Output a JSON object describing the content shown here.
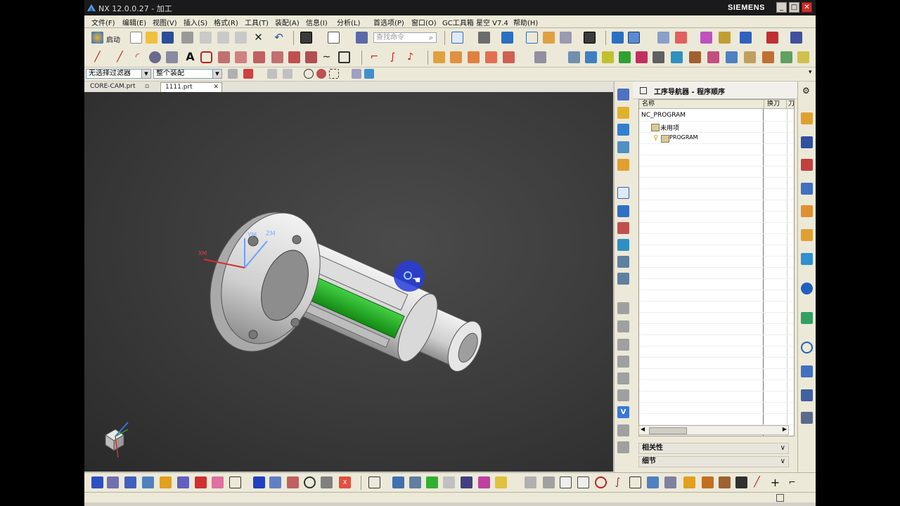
{
  "window": {
    "title": "NX 12.0.0.27 - 加工",
    "brand": "SIEMENS",
    "controls": [
      "minimize",
      "maximize",
      "close"
    ]
  },
  "menu": [
    "文件(F)",
    "编辑(E)",
    "视图(V)",
    "插入(S)",
    "格式(R)",
    "工具(T)",
    "装配(A)",
    "信息(I)",
    "分析(L)",
    "首选项(P)",
    "窗口(O)",
    "GC工具箱",
    "星空 V7.4",
    "帮助(H)"
  ],
  "toolbar": {
    "start_label": "启动",
    "search_placeholder": "查找命令"
  },
  "filters": {
    "selection_filter": "无选择过滤器",
    "assembly_scope": "整个装配"
  },
  "tabs": [
    {
      "label": "CORE-CAM.prt",
      "active": false
    },
    {
      "label": "1111.prt",
      "active": true
    }
  ],
  "viewport": {
    "axes": {
      "x": "XM",
      "y": "YM",
      "z": "ZM"
    },
    "background": "#3c3c3c",
    "highlight_color": "#1faa1f"
  },
  "navigator": {
    "title": "工序导航器 - 程序顺序",
    "columns": [
      "名称",
      "换刀",
      "刀"
    ],
    "tree": [
      {
        "label": "NC_PROGRAM",
        "level": 0,
        "icon": "none"
      },
      {
        "label": "未用项",
        "level": 1,
        "icon": "folder-icon"
      },
      {
        "label": "PROGRAM",
        "level": 1,
        "icon": "folder-icon"
      }
    ],
    "panels": [
      "相关性",
      "细节"
    ]
  }
}
